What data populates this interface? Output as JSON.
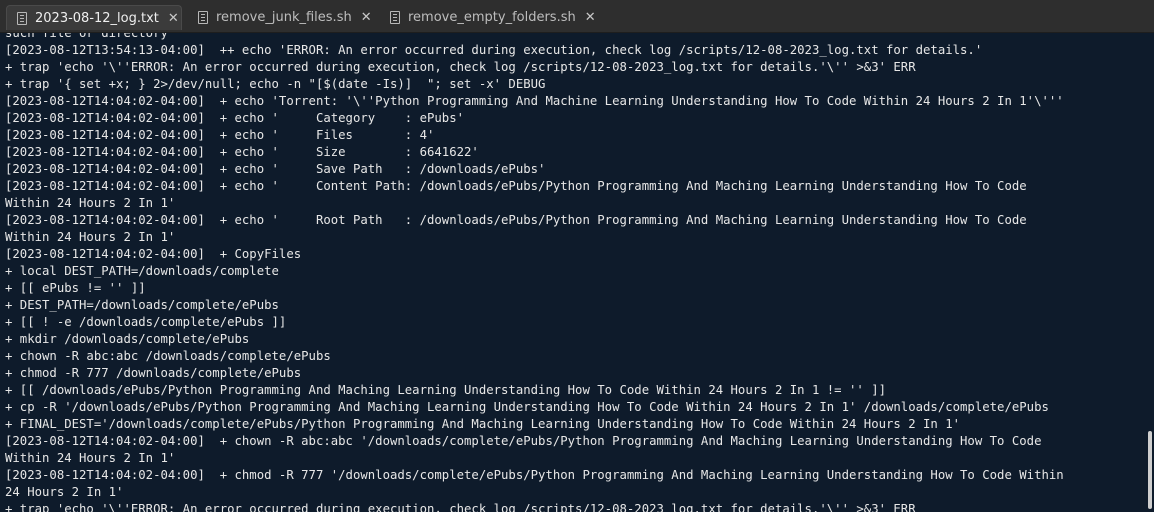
{
  "tabs": [
    {
      "label": "2023-08-12_log.txt",
      "close": "✕",
      "active": true
    },
    {
      "label": "remove_junk_files.sh",
      "close": "✕",
      "active": false
    },
    {
      "label": "remove_empty_folders.sh",
      "close": "✕",
      "active": false
    }
  ],
  "lines": [
    "such file or directory",
    "[2023-08-12T13:54:13-04:00]  ++ echo 'ERROR: An error occurred during execution, check log /scripts/12-08-2023_log.txt for details.'",
    "+ trap 'echo '\\''ERROR: An error occurred during execution, check log /scripts/12-08-2023_log.txt for details.'\\'' >&3' ERR",
    "+ trap '{ set +x; } 2>/dev/null; echo -n \"[$(date -Is)]  \"; set -x' DEBUG",
    "[2023-08-12T14:04:02-04:00]  + echo 'Torrent: '\\''Python Programming And Machine Learning Understanding How To Code Within 24 Hours 2 In 1'\\'''",
    "[2023-08-12T14:04:02-04:00]  + echo '     Category    : ePubs'",
    "[2023-08-12T14:04:02-04:00]  + echo '     Files       : 4'",
    "[2023-08-12T14:04:02-04:00]  + echo '     Size        : 6641622'",
    "[2023-08-12T14:04:02-04:00]  + echo '     Save Path   : /downloads/ePubs'",
    "[2023-08-12T14:04:02-04:00]  + echo '     Content Path: /downloads/ePubs/Python Programming And Maching Learning Understanding How To Code",
    "Within 24 Hours 2 In 1'",
    "[2023-08-12T14:04:02-04:00]  + echo '     Root Path   : /downloads/ePubs/Python Programming And Maching Learning Understanding How To Code",
    "Within 24 Hours 2 In 1'",
    "[2023-08-12T14:04:02-04:00]  + CopyFiles",
    "+ local DEST_PATH=/downloads/complete",
    "+ [[ ePubs != '' ]]",
    "+ DEST_PATH=/downloads/complete/ePubs",
    "+ [[ ! -e /downloads/complete/ePubs ]]",
    "+ mkdir /downloads/complete/ePubs",
    "+ chown -R abc:abc /downloads/complete/ePubs",
    "+ chmod -R 777 /downloads/complete/ePubs",
    "+ [[ /downloads/ePubs/Python Programming And Maching Learning Understanding How To Code Within 24 Hours 2 In 1 != '' ]]",
    "+ cp -R '/downloads/ePubs/Python Programming And Maching Learning Understanding How To Code Within 24 Hours 2 In 1' /downloads/complete/ePubs",
    "+ FINAL_DEST='/downloads/complete/ePubs/Python Programming And Maching Learning Understanding How To Code Within 24 Hours 2 In 1'",
    "[2023-08-12T14:04:02-04:00]  + chown -R abc:abc '/downloads/complete/ePubs/Python Programming And Maching Learning Understanding How To Code",
    "Within 24 Hours 2 In 1'",
    "[2023-08-12T14:04:02-04:00]  + chmod -R 777 '/downloads/complete/ePubs/Python Programming And Maching Learning Understanding How To Code Within",
    "24 Hours 2 In 1'",
    "+ trap 'echo '\\''ERROR: An error occurred during execution, check log /scripts/12-08-2023_log.txt for details.'\\'' >&3' ERR"
  ]
}
